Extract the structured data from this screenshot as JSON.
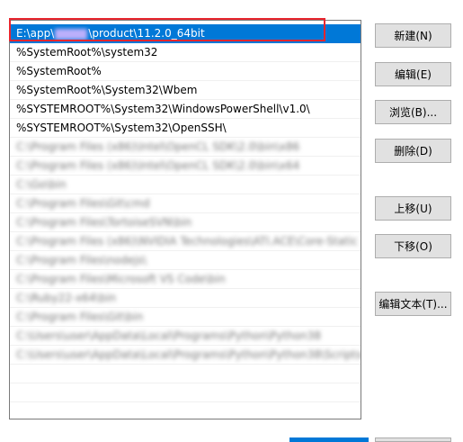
{
  "path_list": {
    "selected": {
      "prefix": "E:\\app\\",
      "suffix": "\\product\\11.2.0_64bit"
    },
    "items": [
      "%SystemRoot%\\system32",
      "%SystemRoot%",
      "%SystemRoot%\\System32\\Wbem",
      "%SYSTEMROOT%\\System32\\WindowsPowerShell\\v1.0\\",
      "%SYSTEMROOT%\\System32\\OpenSSH\\"
    ],
    "blurred_items": [
      "C:\\Program Files (x86)\\Intel\\OpenCL SDK\\2.0\\bin\\x86",
      "C:\\Program Files (x86)\\Intel\\OpenCL SDK\\2.0\\bin\\x64",
      "C:\\Go\\bin",
      "C:\\Program Files\\Git\\cmd",
      "C:\\Program Files\\TortoiseSVN\\bin",
      "C:\\Program Files (x86)\\NVIDIA Technologies\\ATI.ACE\\Core-Static",
      "C:\\Program Files\\nodejs\\",
      "C:\\Program Files\\Microsoft VS Code\\bin",
      "C:\\Ruby22-x64\\bin",
      "C:\\Program Files\\Git\\bin",
      "C:\\Users\\user\\AppData\\Local\\Programs\\Python\\Python38",
      "C:\\Users\\user\\AppData\\Local\\Programs\\Python\\Python38\\Scripts"
    ]
  },
  "buttons": {
    "new": "新建(N)",
    "edit": "编辑(E)",
    "browse": "浏览(B)...",
    "delete": "删除(D)",
    "move_up": "上移(U)",
    "move_down": "下移(O)",
    "edit_text": "编辑文本(T)..."
  }
}
